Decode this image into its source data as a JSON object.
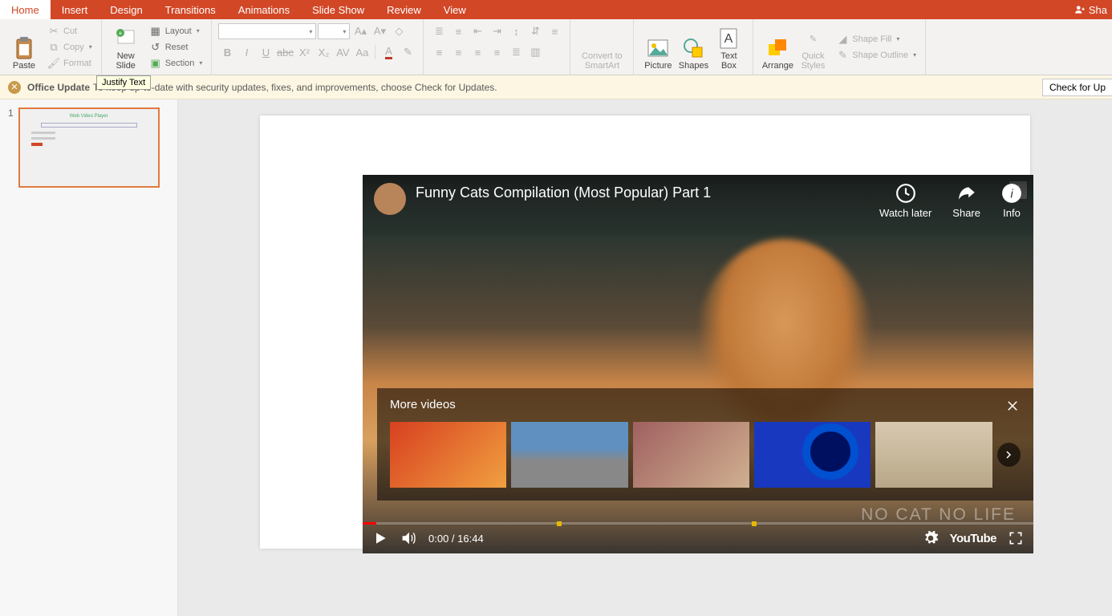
{
  "tabs": [
    "Home",
    "Insert",
    "Design",
    "Transitions",
    "Animations",
    "Slide Show",
    "Review",
    "View"
  ],
  "active_tab": 0,
  "share_label": "Sha",
  "ribbon": {
    "paste": "Paste",
    "cut": "Cut",
    "copy": "Copy",
    "format": "Format",
    "new_slide": "New\nSlide",
    "layout": "Layout",
    "reset": "Reset",
    "section": "Section",
    "convert": "Convert to\nSmartArt",
    "picture": "Picture",
    "shapes": "Shapes",
    "textbox": "Text\nBox",
    "arrange": "Arrange",
    "quick": "Quick\nStyles",
    "shape_fill": "Shape Fill",
    "shape_outline": "Shape Outline"
  },
  "tooltip": "Justify Text",
  "update_bar": {
    "title": "Office Update",
    "message": "To keep up-to-date with security updates, fixes, and improvements, choose Check for Updates.",
    "button": "Check for Up"
  },
  "thumb": {
    "number": "1",
    "title": "Web Video Player"
  },
  "video": {
    "title": "Funny Cats Compilation (Most Popular) Part 1",
    "watch_later": "Watch later",
    "share": "Share",
    "info": "Info",
    "more_videos": "More videos",
    "time": "0:00 / 16:44",
    "watermark": "NO CAT NO LIFE",
    "youtube": "YouTube"
  }
}
